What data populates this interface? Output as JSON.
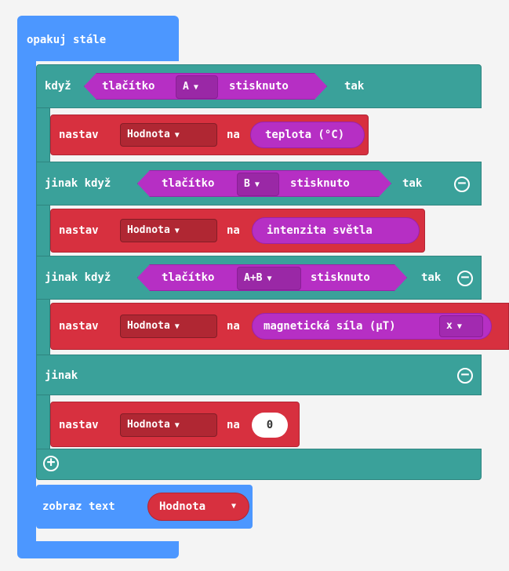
{
  "forever": {
    "label": "opakuj stále"
  },
  "if_block": {
    "if_label": "když",
    "then_label": "tak",
    "else_if_label": "jinak když",
    "else_label": "jinak",
    "conditions": [
      {
        "button_label": "tlačítko",
        "button_value": "A",
        "state": "stisknuto"
      },
      {
        "button_label": "tlačítko",
        "button_value": "B",
        "state": "stisknuto"
      },
      {
        "button_label": "tlačítko",
        "button_value": "A+B",
        "state": "stisknuto"
      }
    ]
  },
  "set_blocks": [
    {
      "set_label": "nastav",
      "variable": "Hodnota",
      "to_label": "na",
      "value": "teplota (°C)"
    },
    {
      "set_label": "nastav",
      "variable": "Hodnota",
      "to_label": "na",
      "value": "intenzita světla"
    },
    {
      "set_label": "nastav",
      "variable": "Hodnota",
      "to_label": "na",
      "value": "magnetická síla (µT)",
      "axis": "x"
    },
    {
      "set_label": "nastav",
      "variable": "Hodnota",
      "to_label": "na",
      "value": "0"
    }
  ],
  "show_text": {
    "label": "zobraz text",
    "variable": "Hodnota"
  },
  "icons": {
    "remove": "minus-circle-icon",
    "add": "plus-circle-icon",
    "dropdown": "caret-down-icon"
  },
  "colors": {
    "loops": "#4c97ff",
    "logic": "#3aa19a",
    "variables": "#d7303f",
    "input": "#b62fc4"
  }
}
